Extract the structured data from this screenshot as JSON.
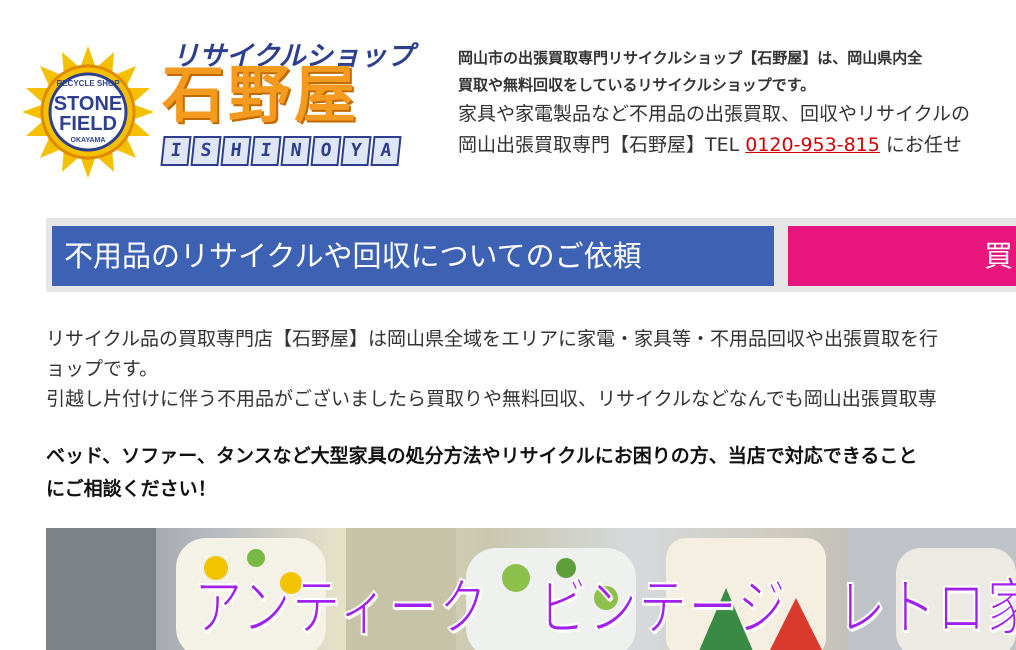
{
  "logo": {
    "sun_top_text": "RECYCLE SHOP",
    "sun_line1": "STONE",
    "sun_line2": "FIELD",
    "sun_bottom_text": "OKAYAMA",
    "kana": "リサイクルショップ",
    "kanji": "石野屋",
    "roman_letters": [
      "I",
      "S",
      "H",
      "I",
      "N",
      "O",
      "Y",
      "A"
    ],
    "colors": {
      "sun": "#f5c000",
      "navy": "#2e3f8f",
      "orange": "#f39a1f"
    }
  },
  "header": {
    "line1": "岡山市の出張買取専門リサイクルショップ【石野屋】は、岡山県内全",
    "line2": "買取や無料回収をしているリサイクルショップです。",
    "line3": "家具や家電製品など不用品の出張買取、回収やリサイクルの",
    "line4_prefix": "岡山出張買取専門【石野屋】TEL ",
    "phone": "0120-953-815",
    "line4_suffix": " にお任せ"
  },
  "banner": {
    "blue_label": "不用品のリサイクルや回収についてのご依頼",
    "pink_label": "買",
    "colors": {
      "blue": "#3d62b3",
      "pink": "#e8157d"
    }
  },
  "intro": {
    "line1": "リサイクル品の買取専門店【石野屋】は岡山県全域をエリアに家電・家具等・不用品回収や出張買取を行",
    "line2": "ョップです。",
    "line3": "引越し片付けに伴う不用品がございましたら買取りや無料回収、リサイクルなどなんでも岡山出張買取専"
  },
  "emphasis": {
    "line1": "ベッド、ソファー、タンスなど大型家具の処分方法やリサイクルにお困りの方、当店で対応できること",
    "line2": "にご相談ください！"
  },
  "photo": {
    "title": "アンティーク　ビンテージ　レトロ家具やおもちゃ、雑"
  }
}
